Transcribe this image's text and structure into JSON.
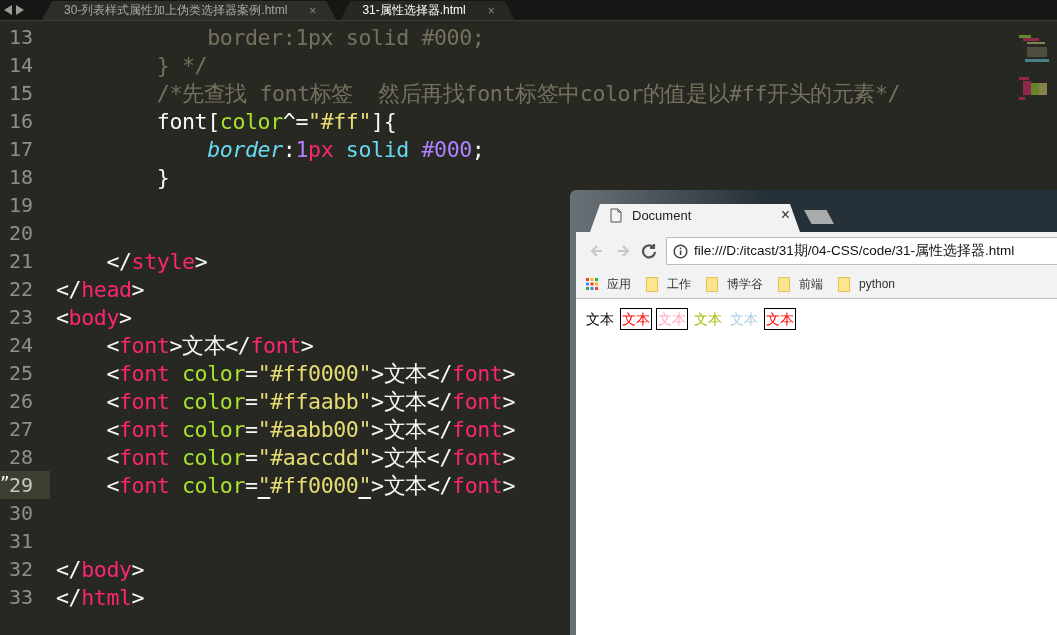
{
  "editor": {
    "tabs": [
      {
        "label": "30-列表样式属性加上伪类选择器案例.html",
        "selected": false
      },
      {
        "label": "31-属性选择器.html",
        "selected": true
      }
    ],
    "lines": [
      {
        "number": "13",
        "current": false,
        "tokens": [
          {
            "kind": "comment",
            "text": "            border:1px solid #000;"
          }
        ]
      },
      {
        "number": "14",
        "current": false,
        "tokens": [
          {
            "kind": "comment",
            "text": "        } */"
          }
        ]
      },
      {
        "number": "15",
        "current": false,
        "tokens": [
          {
            "kind": "comment",
            "text": "        /*先查找 font标签  然后再找font标签中color的值是以#ff开头的元素*/"
          }
        ]
      },
      {
        "number": "16",
        "current": false,
        "tokens": [
          {
            "kind": "punct",
            "text": "        font["
          },
          {
            "kind": "attr",
            "text": "color"
          },
          {
            "kind": "punct",
            "text": "^="
          },
          {
            "kind": "string",
            "text": "\"#ff\""
          },
          {
            "kind": "punct",
            "text": "]{"
          }
        ]
      },
      {
        "number": "17",
        "current": false,
        "tokens": [
          {
            "kind": "prop",
            "text": "            border"
          },
          {
            "kind": "punct",
            "text": ":"
          },
          {
            "kind": "num",
            "text": "1"
          },
          {
            "kind": "tag",
            "text": "px"
          },
          {
            "kind": "value",
            "text": " solid "
          },
          {
            "kind": "num",
            "text": "#000"
          },
          {
            "kind": "punct",
            "text": ";"
          }
        ]
      },
      {
        "number": "18",
        "current": false,
        "tokens": [
          {
            "kind": "punct",
            "text": "        }"
          }
        ]
      },
      {
        "number": "19",
        "current": false
      },
      {
        "number": "20",
        "current": false
      },
      {
        "number": "21",
        "current": false,
        "tokens": [
          {
            "kind": "punct",
            "text": "    </"
          },
          {
            "kind": "tag",
            "text": "style"
          },
          {
            "kind": "punct",
            "text": ">"
          }
        ]
      },
      {
        "number": "22",
        "current": false,
        "tokens": [
          {
            "kind": "punct",
            "text": "</"
          },
          {
            "kind": "tag",
            "text": "head"
          },
          {
            "kind": "punct",
            "text": ">"
          }
        ]
      },
      {
        "number": "23",
        "current": false,
        "tokens": [
          {
            "kind": "punct",
            "text": "<"
          },
          {
            "kind": "tag",
            "text": "body"
          },
          {
            "kind": "punct",
            "text": ">"
          }
        ]
      },
      {
        "number": "24",
        "current": false,
        "tokens": [
          {
            "kind": "punct",
            "text": "    <"
          },
          {
            "kind": "tag",
            "text": "font"
          },
          {
            "kind": "punct",
            "text": ">文本</"
          },
          {
            "kind": "tag",
            "text": "font"
          },
          {
            "kind": "punct",
            "text": ">"
          }
        ]
      },
      {
        "number": "25",
        "current": false,
        "tokens": [
          {
            "kind": "punct",
            "text": "    <"
          },
          {
            "kind": "tag",
            "text": "font"
          },
          {
            "kind": "attr",
            "text": " color"
          },
          {
            "kind": "punct",
            "text": "="
          },
          {
            "kind": "string",
            "text": "\"#ff0000\""
          },
          {
            "kind": "punct",
            "text": ">文本</"
          },
          {
            "kind": "tag",
            "text": "font"
          },
          {
            "kind": "punct",
            "text": ">"
          }
        ]
      },
      {
        "number": "26",
        "current": false,
        "tokens": [
          {
            "kind": "punct",
            "text": "    <"
          },
          {
            "kind": "tag",
            "text": "font"
          },
          {
            "kind": "attr",
            "text": " color"
          },
          {
            "kind": "punct",
            "text": "="
          },
          {
            "kind": "string",
            "text": "\"#ffaabb\""
          },
          {
            "kind": "punct",
            "text": ">文本</"
          },
          {
            "kind": "tag",
            "text": "font"
          },
          {
            "kind": "punct",
            "text": ">"
          }
        ]
      },
      {
        "number": "27",
        "current": false,
        "tokens": [
          {
            "kind": "punct",
            "text": "    <"
          },
          {
            "kind": "tag",
            "text": "font"
          },
          {
            "kind": "attr",
            "text": " color"
          },
          {
            "kind": "punct",
            "text": "="
          },
          {
            "kind": "string",
            "text": "\"#aabb00\""
          },
          {
            "kind": "punct",
            "text": ">文本</"
          },
          {
            "kind": "tag",
            "text": "font"
          },
          {
            "kind": "punct",
            "text": ">"
          }
        ]
      },
      {
        "number": "28",
        "current": false,
        "tokens": [
          {
            "kind": "punct",
            "text": "    <"
          },
          {
            "kind": "tag",
            "text": "font"
          },
          {
            "kind": "attr",
            "text": " color"
          },
          {
            "kind": "punct",
            "text": "="
          },
          {
            "kind": "string",
            "text": "\"#aaccdd\""
          },
          {
            "kind": "punct",
            "text": ">文本</"
          },
          {
            "kind": "tag",
            "text": "font"
          },
          {
            "kind": "punct",
            "text": ">"
          }
        ]
      },
      {
        "number": "29",
        "current": true,
        "marker": "”",
        "tokens": [
          {
            "kind": "punct",
            "text": "    <"
          },
          {
            "kind": "tag",
            "text": "font"
          },
          {
            "kind": "attr",
            "text": " color"
          },
          {
            "kind": "punct",
            "text": "="
          },
          {
            "kind": "string",
            "text": "\"#ff0000\"",
            "matched": true
          },
          {
            "kind": "punct",
            "text": ">文本</"
          },
          {
            "kind": "tag",
            "text": "font"
          },
          {
            "kind": "punct",
            "text": ">"
          }
        ]
      },
      {
        "number": "30",
        "current": false
      },
      {
        "number": "31",
        "current": false
      },
      {
        "number": "32",
        "current": false,
        "tokens": [
          {
            "kind": "punct",
            "text": "</"
          },
          {
            "kind": "tag",
            "text": "body"
          },
          {
            "kind": "punct",
            "text": ">"
          }
        ]
      },
      {
        "number": "33",
        "current": false,
        "tokens": [
          {
            "kind": "punct",
            "text": "</"
          },
          {
            "kind": "tag",
            "text": "html"
          },
          {
            "kind": "punct",
            "text": ">"
          }
        ]
      }
    ]
  },
  "browser": {
    "tab": {
      "title": "Document",
      "close": "×"
    },
    "nav": [
      {
        "kind": "back",
        "disabled": true
      },
      {
        "kind": "forward",
        "disabled": true
      },
      {
        "kind": "reload",
        "disabled": false
      }
    ],
    "url": "file:///D:/itcast/31期/04-CSS/code/31-属性选择器.html",
    "bookmarks": [
      {
        "kind": "apps",
        "label": "应用"
      },
      {
        "kind": "folder",
        "label": "工作"
      },
      {
        "kind": "folder",
        "label": "博学谷"
      },
      {
        "kind": "folder",
        "label": "前端"
      },
      {
        "kind": "folder",
        "label": "python"
      }
    ],
    "content": [
      {
        "text": "文本",
        "color": "#000000",
        "bordered": false
      },
      {
        "text": "文本",
        "color": "#ff0000",
        "bordered": true
      },
      {
        "text": "文本",
        "color": "#ffaabb",
        "bordered": true
      },
      {
        "text": "文本",
        "color": "#aabb00",
        "bordered": false
      },
      {
        "text": "文本",
        "color": "#aaccdd",
        "bordered": false
      },
      {
        "text": "文本",
        "color": "#ff0000",
        "bordered": true
      }
    ]
  }
}
